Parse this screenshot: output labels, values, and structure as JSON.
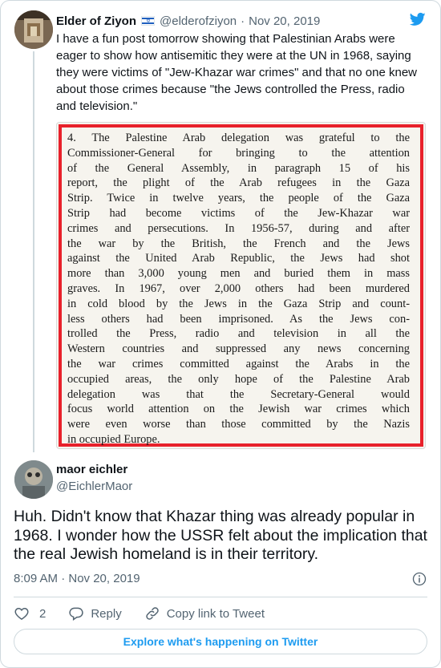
{
  "parent_tweet": {
    "author_name": "Elder of Ziyon",
    "handle": "@elderofziyon",
    "separator": "·",
    "date": "Nov 20, 2019",
    "text": "I have a fun post tomorrow showing that Palestinian Arabs were eager to show how antisemitic they were at the UN in 1968, saying they were victims of \"Jew-Khazar war crimes\" and that no one knew about those  crimes because \"the Jews controlled the Press, radio and television.\"",
    "flag_icon": "israel-flag-icon",
    "brand_icon": "twitter-bird-icon",
    "brand_color": "#1d9bf0",
    "document_image": {
      "lines": [
        "4.  The Palestine Arab delegation was grateful to the",
        "Commissioner-General for bringing to the attention",
        "of the General Assembly, in paragraph 15 of his",
        "report, the plight of the Arab refugees in the Gaza",
        "Strip. Twice in twelve years, the people of the Gaza",
        "Strip had become victims of the Jew-Khazar war",
        "crimes and persecutions. In 1956-57, during and after",
        "the war by the British, the French and the Jews",
        "against the United Arab Republic, the Jews had shot",
        "more than 3,000 young men and buried them in mass",
        "graves. In 1967, over 2,000 others had been murdered",
        "in cold blood by the Jews in the Gaza Strip and count-",
        "less others had been imprisoned. As the Jews con-",
        "trolled the Press, radio and television in all the",
        "Western countries and suppressed any news concerning",
        "the war crimes committed against the Arabs in the",
        "occupied areas, the only hope of the Palestine Arab",
        "delegation was that the Secretary-General would",
        "focus world attention on the Jewish war crimes which",
        "were even worse than those committed by the Nazis",
        "in occupied Europe."
      ],
      "highlight_color": "#e8212b"
    }
  },
  "reply_tweet": {
    "author_name": "maor eichler",
    "handle": "@EichlerMaor",
    "text": "Huh. Didn't know that Khazar thing was already popular in 1968. I wonder how the USSR felt about the implication that the real Jewish homeland is in their territory.",
    "time": "8:09 AM · Nov 20, 2019",
    "info_icon": "info-icon"
  },
  "actions": {
    "like_count": "2",
    "reply_label": "Reply",
    "copy_link_label": "Copy link to Tweet"
  },
  "explore_button": "Explore what's happening on Twitter"
}
